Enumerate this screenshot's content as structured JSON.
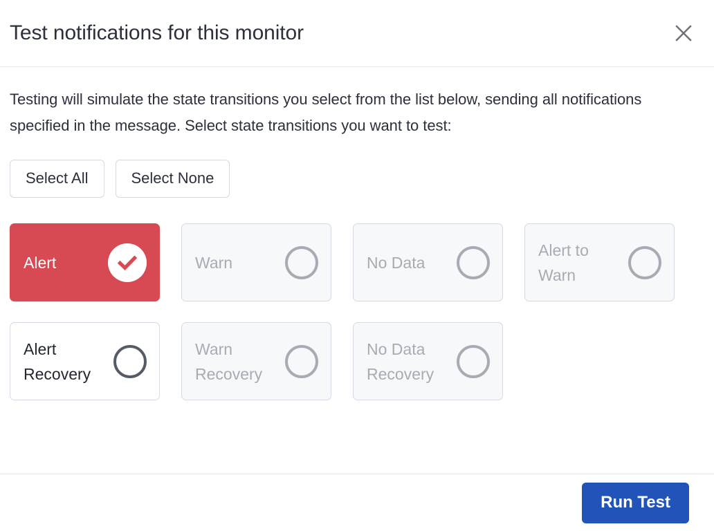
{
  "modal": {
    "title": "Test notifications for this monitor",
    "close_icon": "close-icon",
    "intro": "Testing will simulate the state transitions you select from the list below, sending all notifications specified in the message. Select state transitions you want to test:",
    "actions": {
      "select_all": "Select All",
      "select_none": "Select None"
    },
    "state_cards": [
      {
        "label": "Alert",
        "state": "selected",
        "marker": "check-circle-filled-icon"
      },
      {
        "label": "Warn",
        "state": "disabled",
        "marker": "circle-outline-icon"
      },
      {
        "label": "No Data",
        "state": "disabled",
        "marker": "circle-outline-icon"
      },
      {
        "label": "Alert to\nWarn",
        "state": "disabled",
        "marker": "circle-outline-icon"
      },
      {
        "label": "Alert\nRecovery",
        "state": "enabled",
        "marker": "circle-outline-icon"
      },
      {
        "label": "Warn\nRecovery",
        "state": "disabled",
        "marker": "circle-outline-icon"
      },
      {
        "label": "No Data\nRecovery",
        "state": "disabled",
        "marker": "circle-outline-icon"
      }
    ],
    "footer": {
      "run_test": "Run Test"
    }
  },
  "colors": {
    "selected_red": "#d74a53",
    "primary_blue": "#2253b8",
    "card_border": "#d6d9e3",
    "card_background": "#f7f8fa",
    "muted_text": "#a7acb4",
    "title_text": "#2b303b"
  }
}
